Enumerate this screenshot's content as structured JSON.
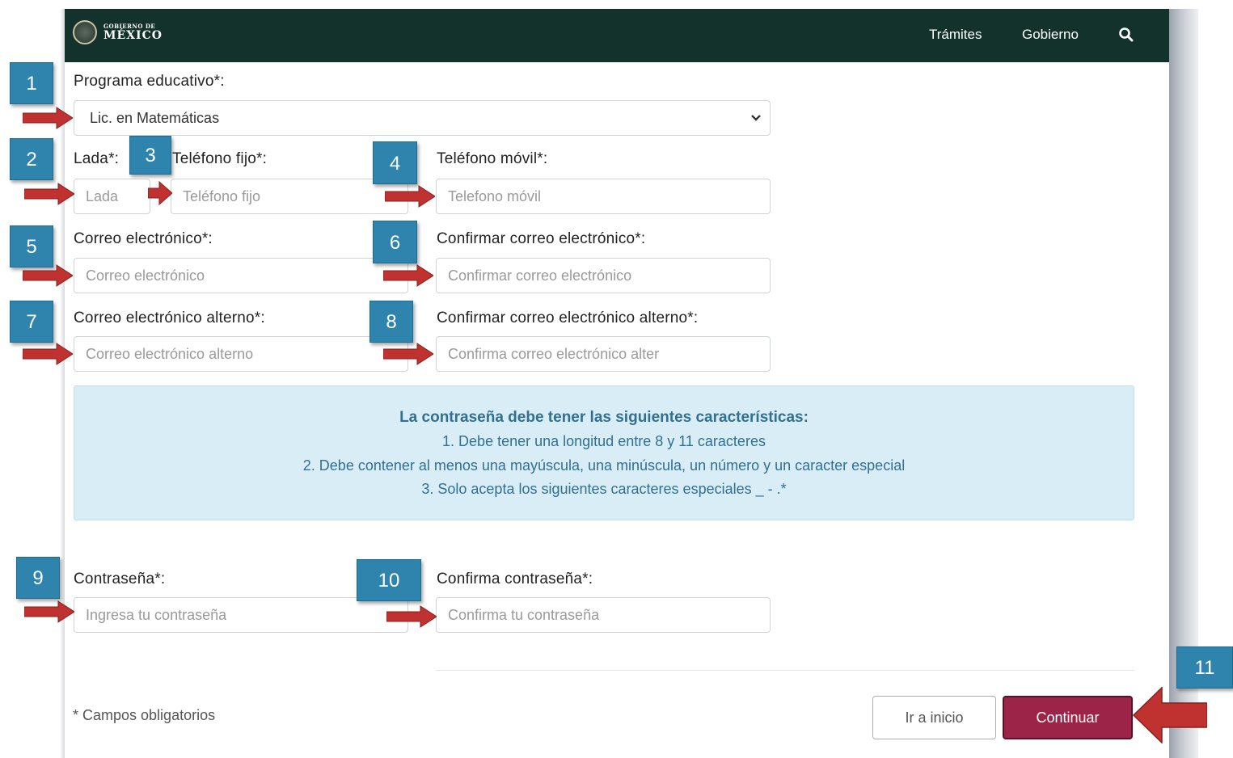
{
  "header": {
    "logo_small": "GOBIERNO DE",
    "logo_big": "MÉXICO",
    "nav": [
      "Trámites",
      "Gobierno"
    ]
  },
  "form": {
    "programa_label": "Programa educativo*:",
    "programa_value": "Lic. en Matemáticas",
    "lada_label": "Lada*:",
    "lada_placeholder": "Lada",
    "telefono_fijo_label": "Teléfono fijo*:",
    "telefono_fijo_placeholder": "Teléfono fijo",
    "telefono_movil_label": "Teléfono móvil*:",
    "telefono_movil_placeholder": "Telefono móvil",
    "correo_label": "Correo electrónico*:",
    "correo_placeholder": "Correo electrónico",
    "confirmar_correo_label": "Confirmar correo electrónico*:",
    "confirmar_correo_placeholder": "Confirmar correo electrónico",
    "correo_alterno_label": "Correo electrónico alterno*:",
    "correo_alterno_placeholder": "Correo electrónico alterno",
    "confirmar_correo_alterno_label": "Confirmar correo electrónico alterno*:",
    "confirmar_correo_alterno_placeholder": "Confirma correo electrónico alter",
    "password_label": "Contraseña*:",
    "password_placeholder": "Ingresa tu contraseña",
    "confirm_password_label": "Confirma contraseña*:",
    "confirm_password_placeholder": "Confirma tu contraseña",
    "required_note": "* Campos obligatorios"
  },
  "info": {
    "title": "La contraseña debe tener las siguientes características:",
    "lines": [
      "1. Debe tener una longitud entre 8 y 11 caracteres",
      "2. Debe contener al menos una mayúscula, una minúscula, un número y un caracter especial",
      "3. Solo acepta los siguientes caracteres especiales _ - .*"
    ]
  },
  "buttons": {
    "inicio": "Ir a inicio",
    "continuar": "Continuar"
  },
  "callouts": [
    "1",
    "2",
    "3",
    "4",
    "5",
    "6",
    "7",
    "8",
    "9",
    "10",
    "11"
  ],
  "colors": {
    "header_bg": "#13322b",
    "primary": "#9d2449",
    "info_bg": "#d9edf7",
    "info_text": "#31708f",
    "callout": "#2f84ad",
    "arrow": "#c0322f"
  }
}
